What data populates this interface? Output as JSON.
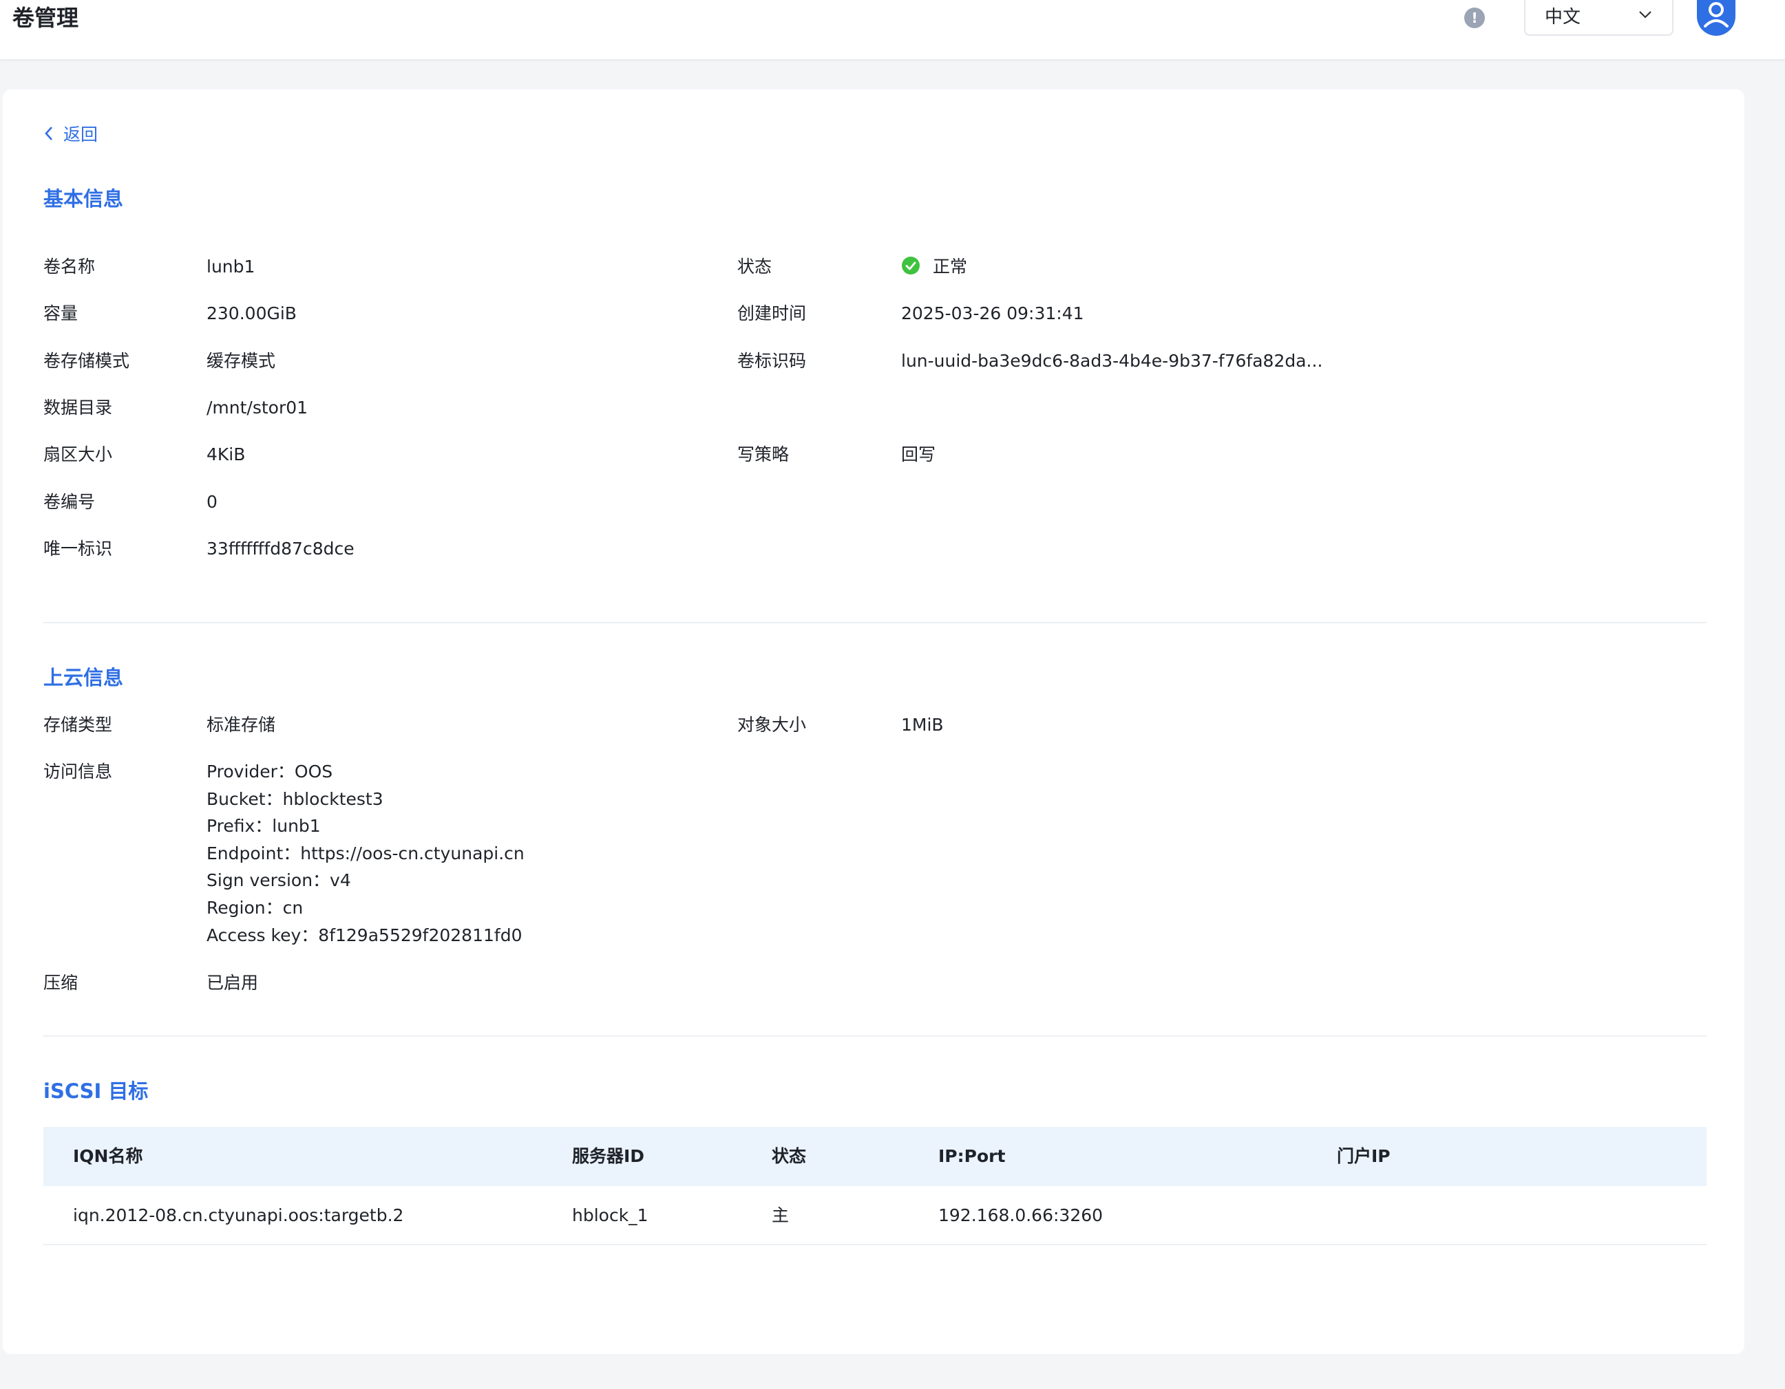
{
  "header": {
    "title": "卷管理",
    "language": "中文"
  },
  "back_label": "返回",
  "basic_info": {
    "title": "基本信息",
    "left_fields": [
      {
        "label": "卷名称",
        "value": "lunb1"
      },
      {
        "label": "容量",
        "value": "230.00GiB"
      },
      {
        "label": "卷存储模式",
        "value": "缓存模式"
      },
      {
        "label": "数据目录",
        "value": "/mnt/stor01"
      },
      {
        "label": "扇区大小",
        "value": "4KiB"
      },
      {
        "label": "卷编号",
        "value": "0"
      },
      {
        "label": "唯一标识",
        "value": "33fffffffd87c8dce"
      }
    ],
    "right_fields": {
      "status": {
        "label": "状态",
        "value": "正常"
      },
      "created": {
        "label": "创建时间",
        "value": "2025-03-26 09:31:41"
      },
      "volume_id": {
        "label": "卷标识码",
        "value": "lun-uuid-ba3e9dc6-8ad3-4b4e-9b37-f76fa82da..."
      },
      "write_policy": {
        "label": "写策略",
        "value": "回写"
      }
    }
  },
  "cloud_info": {
    "title": "上云信息",
    "storage_type": {
      "label": "存储类型",
      "value": "标准存储"
    },
    "object_size": {
      "label": "对象大小",
      "value": "1MiB"
    },
    "access": {
      "label": "访问信息",
      "lines": [
        "Provider：OOS",
        "Bucket：hblocktest3",
        "Prefix：lunb1",
        "Endpoint：https://oos-cn.ctyunapi.cn",
        "Sign version：v4",
        "Region：cn",
        "Access key：8f129a5529f202811fd0"
      ]
    },
    "compression": {
      "label": "压缩",
      "value": "已启用"
    }
  },
  "iscsi": {
    "title": "iSCSI 目标",
    "columns": [
      "IQN名称",
      "服务器ID",
      "状态",
      "IP:Port",
      "门户IP"
    ],
    "rows": [
      [
        "iqn.2012-08.cn.ctyunapi.oos:targetb.2",
        "hblock_1",
        "主",
        "192.168.0.66:3260",
        ""
      ]
    ]
  },
  "colors": {
    "accent": "#2f6fe4",
    "status_ok": "#3fc23f",
    "table_header_bg": "#ebf3fd"
  }
}
